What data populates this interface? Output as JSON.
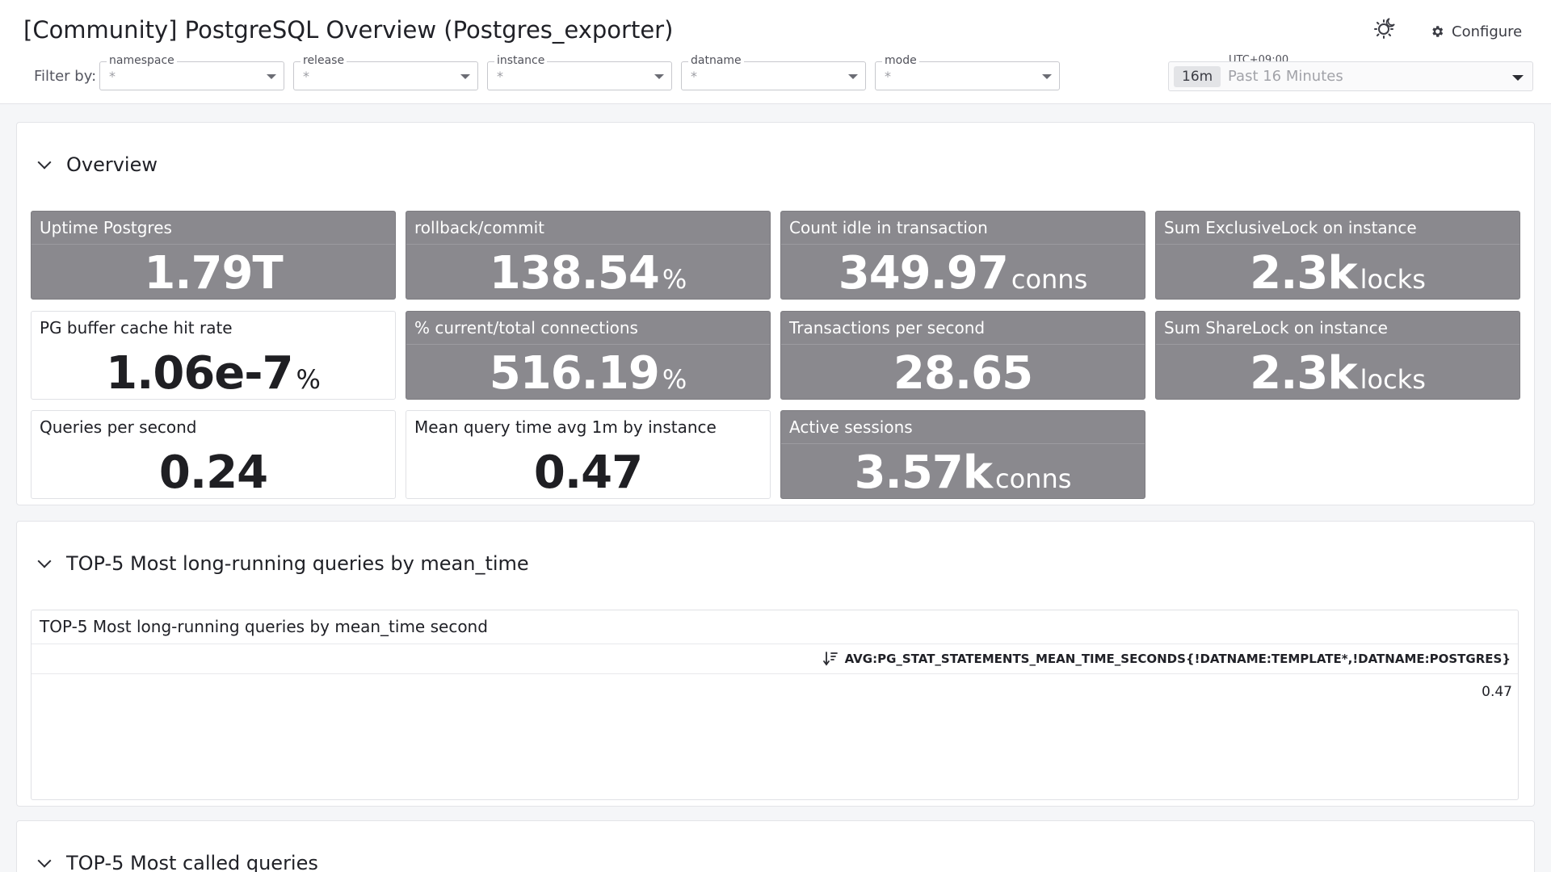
{
  "header": {
    "title": "[Community] PostgreSQL Overview (Postgres_exporter)",
    "configure_label": "Configure",
    "theme_icon": "theme-toggle-icon",
    "configure_icon": "gear-icon"
  },
  "filters": {
    "label": "Filter by:",
    "items": [
      {
        "name": "namespace",
        "value": "*"
      },
      {
        "name": "release",
        "value": "*"
      },
      {
        "name": "instance",
        "value": "*"
      },
      {
        "name": "datname",
        "value": "*"
      },
      {
        "name": "mode",
        "value": "*"
      }
    ]
  },
  "time": {
    "timezone": "UTC+09:00",
    "badge": "16m",
    "range_text": "Past 16 Minutes"
  },
  "overview": {
    "title": "Overview",
    "tiles": [
      {
        "name": "Uptime Postgres",
        "value": "1.79T",
        "unit": "",
        "style": "dark"
      },
      {
        "name": "rollback/commit",
        "value": "138.54",
        "unit": "%",
        "style": "dark"
      },
      {
        "name": "Count idle in transaction",
        "value": "349.97",
        "unit": "conns",
        "style": "dark"
      },
      {
        "name": "Sum ExclusiveLock on instance",
        "value": "2.3k",
        "unit": "locks",
        "style": "dark"
      },
      {
        "name": "PG buffer cache hit rate",
        "value": "1.06e-7",
        "unit": "%",
        "style": "light"
      },
      {
        "name": "% current/total connections",
        "value": "516.19",
        "unit": "%",
        "style": "dark"
      },
      {
        "name": "Transactions per second",
        "value": "28.65",
        "unit": "",
        "style": "dark"
      },
      {
        "name": "Sum ShareLock on instance",
        "value": "2.3k",
        "unit": "locks",
        "style": "dark"
      },
      {
        "name": "Queries per second",
        "value": "0.24",
        "unit": "",
        "style": "light"
      },
      {
        "name": "Mean query time avg 1m by instance",
        "value": "0.47",
        "unit": "",
        "style": "light"
      },
      {
        "name": "Active sessions",
        "value": "3.57k",
        "unit": "conns",
        "style": "dark"
      }
    ]
  },
  "top_mean_time": {
    "title": "TOP-5 Most long-running queries by mean_time",
    "panel_title": "TOP-5 Most long-running queries by mean_time second",
    "column": "AVG:PG_STAT_STATEMENTS_MEAN_TIME_SECONDS{!DATNAME:TEMPLATE*,!DATNAME:POSTGRES}",
    "rows": [
      "0.47"
    ]
  },
  "top_called": {
    "title": "TOP-5 Most called queries"
  },
  "colors": {
    "dark_tile": "#8a898e",
    "light_tile": "#ffffff",
    "page_bg": "#f5f6f8"
  }
}
